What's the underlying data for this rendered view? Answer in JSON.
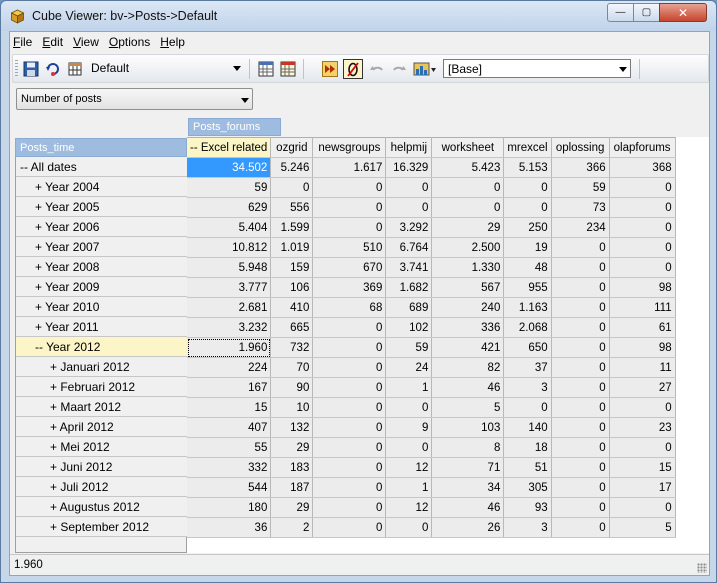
{
  "window": {
    "title": "Cube Viewer: bv->Posts->Default",
    "controls": {
      "minimize": "—",
      "maximize": "▢",
      "close": "✕"
    }
  },
  "menu": [
    {
      "label": "File",
      "key": "F",
      "rest": "ile"
    },
    {
      "label": "Edit",
      "key": "E",
      "rest": "dit"
    },
    {
      "label": "View",
      "key": "V",
      "rest": "iew"
    },
    {
      "label": "Options",
      "key": "O",
      "rest": "ptions"
    },
    {
      "label": "Help",
      "key": "H",
      "rest": "elp"
    }
  ],
  "toolbar": {
    "view_combo": "Default",
    "alias_combo": "[Base]"
  },
  "measure": {
    "selected": "Number of posts"
  },
  "dimensions": {
    "columns": "Posts_forums",
    "rows": "Posts_time"
  },
  "columns": [
    "-- Excel related",
    "ozgrid",
    "newsgroups",
    "helpmij",
    "worksheet",
    "mrexcel",
    "oplossing",
    "olapforums"
  ],
  "rows": [
    {
      "label": "-- All dates",
      "indent": 0,
      "values": [
        "34.502",
        "5.246",
        "1.617",
        "16.329",
        "5.423",
        "5.153",
        "366",
        "368"
      ]
    },
    {
      "label": "+ Year 2004",
      "indent": 1,
      "values": [
        "59",
        "0",
        "0",
        "0",
        "0",
        "0",
        "59",
        "0"
      ]
    },
    {
      "label": "+ Year 2005",
      "indent": 1,
      "values": [
        "629",
        "556",
        "0",
        "0",
        "0",
        "0",
        "73",
        "0"
      ]
    },
    {
      "label": "+ Year 2006",
      "indent": 1,
      "values": [
        "5.404",
        "1.599",
        "0",
        "3.292",
        "29",
        "250",
        "234",
        "0"
      ]
    },
    {
      "label": "+ Year 2007",
      "indent": 1,
      "values": [
        "10.812",
        "1.019",
        "510",
        "6.764",
        "2.500",
        "19",
        "0",
        "0"
      ]
    },
    {
      "label": "+ Year 2008",
      "indent": 1,
      "values": [
        "5.948",
        "159",
        "670",
        "3.741",
        "1.330",
        "48",
        "0",
        "0"
      ]
    },
    {
      "label": "+ Year 2009",
      "indent": 1,
      "values": [
        "3.777",
        "106",
        "369",
        "1.682",
        "567",
        "955",
        "0",
        "98"
      ]
    },
    {
      "label": "+ Year 2010",
      "indent": 1,
      "values": [
        "2.681",
        "410",
        "68",
        "689",
        "240",
        "1.163",
        "0",
        "111"
      ]
    },
    {
      "label": "+ Year 2011",
      "indent": 1,
      "values": [
        "3.232",
        "665",
        "0",
        "102",
        "336",
        "2.068",
        "0",
        "61"
      ]
    },
    {
      "label": "-- Year 2012",
      "indent": 1,
      "values": [
        "1.960",
        "732",
        "0",
        "59",
        "421",
        "650",
        "0",
        "98"
      ]
    },
    {
      "label": "+ Januari 2012",
      "indent": 2,
      "values": [
        "224",
        "70",
        "0",
        "24",
        "82",
        "37",
        "0",
        "11"
      ]
    },
    {
      "label": "+ Februari 2012",
      "indent": 2,
      "values": [
        "167",
        "90",
        "0",
        "1",
        "46",
        "3",
        "0",
        "27"
      ]
    },
    {
      "label": "+ Maart 2012",
      "indent": 2,
      "values": [
        "15",
        "10",
        "0",
        "0",
        "5",
        "0",
        "0",
        "0"
      ]
    },
    {
      "label": "+ April 2012",
      "indent": 2,
      "values": [
        "407",
        "132",
        "0",
        "9",
        "103",
        "140",
        "0",
        "23"
      ]
    },
    {
      "label": "+ Mei 2012",
      "indent": 2,
      "values": [
        "55",
        "29",
        "0",
        "0",
        "8",
        "18",
        "0",
        "0"
      ]
    },
    {
      "label": "+ Juni 2012",
      "indent": 2,
      "values": [
        "332",
        "183",
        "0",
        "12",
        "71",
        "51",
        "0",
        "15"
      ]
    },
    {
      "label": "+ Juli 2012",
      "indent": 2,
      "values": [
        "544",
        "187",
        "0",
        "1",
        "34",
        "305",
        "0",
        "17"
      ]
    },
    {
      "label": "+ Augustus 2012",
      "indent": 2,
      "values": [
        "180",
        "29",
        "0",
        "12",
        "46",
        "93",
        "0",
        "0"
      ]
    },
    {
      "label": "+ September 2012",
      "indent": 2,
      "values": [
        "36",
        "2",
        "0",
        "0",
        "26",
        "3",
        "0",
        "5"
      ]
    }
  ],
  "status": {
    "text": "1.960"
  }
}
